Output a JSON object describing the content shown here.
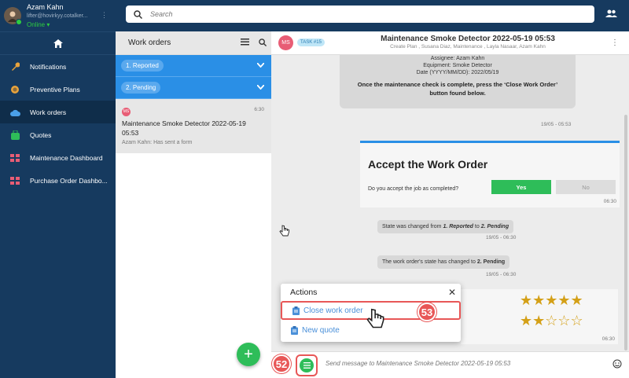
{
  "profile": {
    "name": "Azam Kahn",
    "email": "lifter@hovirkyy.cotalker...",
    "status": "Online",
    "status_caret": "▾",
    "menu_glyph": "⋮"
  },
  "sidebar": {
    "items": [
      {
        "label": "Notifications",
        "icon": "wrench-icon",
        "color": "#e8a33c"
      },
      {
        "label": "Preventive Plans",
        "icon": "gauge-icon",
        "color": "#e8a33c"
      },
      {
        "label": "Work orders",
        "icon": "cloud-icon",
        "color": "#4a9fe8",
        "active": true
      },
      {
        "label": "Quotes",
        "icon": "bag-icon",
        "color": "#2ebd59"
      },
      {
        "label": "Maintenance Dashboard",
        "icon": "grid-icon",
        "color": "#e85d75"
      },
      {
        "label": "Purchase Order Dashbo...",
        "icon": "grid-icon",
        "color": "#e85d75"
      }
    ]
  },
  "search": {
    "placeholder": "Search"
  },
  "work_orders": {
    "title": "Work orders",
    "groups": [
      "1. Reported",
      "2. Pending"
    ],
    "card": {
      "badge": "MS",
      "time": "6:30",
      "title": "Maintenance Smoke Detector 2022-05-19 05:53",
      "subtitle": "Azam Kahn: Has sent a form"
    },
    "fab_label": "+"
  },
  "chat": {
    "avatar": "MS",
    "task_tag": "TASK #15",
    "title": "Maintenance Smoke Detector 2022-05-19 05:53",
    "subtitle": "Create Plan , Susana Diaz, Maintenance , Layla Nasaar, Azam Kahn",
    "menu_glyph": "⋮",
    "info": {
      "assignee_label": "Assignee:",
      "assignee": "Azam Kahn",
      "equipment_label": "Equipment:",
      "equipment": "Smoke Detector",
      "date_label": "Date (YYYY/MM/DD):",
      "date": "2022/05/19",
      "instruction": "Once the maintenance check is complete, press the ‘Close Work Order’ button found below.",
      "timestamp": "19/05 - 05:53"
    },
    "accept": {
      "title": "Accept the Work Order",
      "question": "Do you accept the job as completed?",
      "yes": "Yes",
      "no": "No",
      "timestamp": "06:30"
    },
    "state_change": {
      "prefix": "State was changed from",
      "from": "1. Reported",
      "connector": "to",
      "to": "2. Pending",
      "timestamp": "19/05 - 06:30"
    },
    "state_now": {
      "prefix": "The work order's state has changed to",
      "state": "2. Pending",
      "timestamp": "19/05 - 06:30"
    },
    "rating": {
      "row1": "★★★★★",
      "row2": "★★☆☆☆",
      "timestamp": "06:30"
    },
    "actions": {
      "title": "Actions",
      "close_glyph": "✕",
      "items": [
        "Close work order",
        "New quote"
      ]
    },
    "composer_placeholder": "Send message to Maintenance Smoke Detector 2022-05-19 05:53"
  },
  "steps": [
    "52",
    "53"
  ]
}
